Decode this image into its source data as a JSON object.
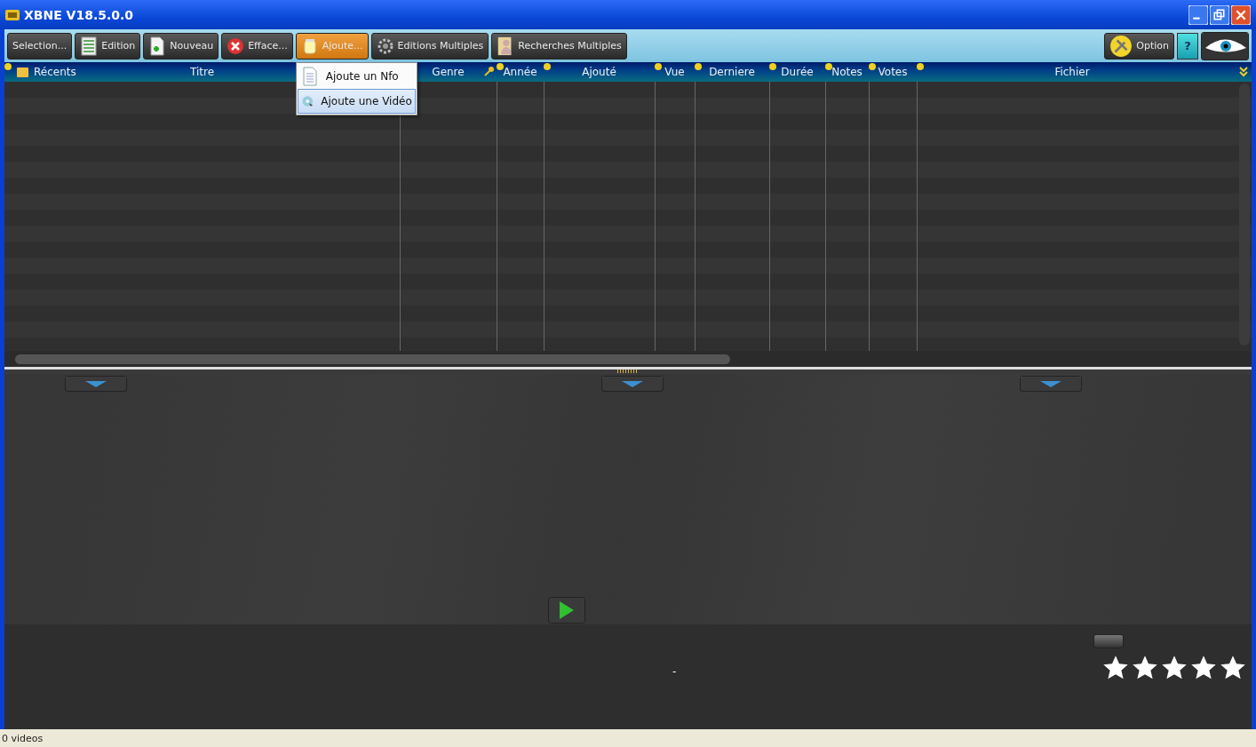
{
  "window": {
    "title": "XBNE V18.5.0.0"
  },
  "toolbar": [
    {
      "label": "Selection...",
      "kind": "text",
      "selected": false
    },
    {
      "label": "Edition",
      "kind": "list",
      "selected": false
    },
    {
      "label": "Nouveau",
      "kind": "new",
      "selected": false
    },
    {
      "label": "Efface...",
      "kind": "delete",
      "selected": false
    },
    {
      "label": "Ajoute...",
      "kind": "add",
      "selected": true
    },
    {
      "label": "Editions Multiples",
      "kind": "gear",
      "selected": false
    },
    {
      "label": "Recherches Multiples",
      "kind": "person",
      "selected": false
    }
  ],
  "toolbar_right": [
    {
      "label": "Option",
      "kind": "tools"
    },
    {
      "label": "?",
      "kind": "help"
    },
    {
      "kind": "eye"
    }
  ],
  "menu": [
    {
      "label": "Ajoute un Nfo",
      "kind": "document",
      "selected": false
    },
    {
      "label": "Ajoute une Vidéo",
      "kind": "disc",
      "selected": true
    }
  ],
  "table": {
    "columns": [
      "Récents",
      "Titre",
      "Genre",
      "Année",
      "Ajouté",
      "Vue",
      "Derniere",
      "Durée",
      "Notes",
      "Votes",
      "Fichier"
    ]
  },
  "detail": {
    "text": "-",
    "stars": 5
  },
  "status_bar": "0 videos"
}
